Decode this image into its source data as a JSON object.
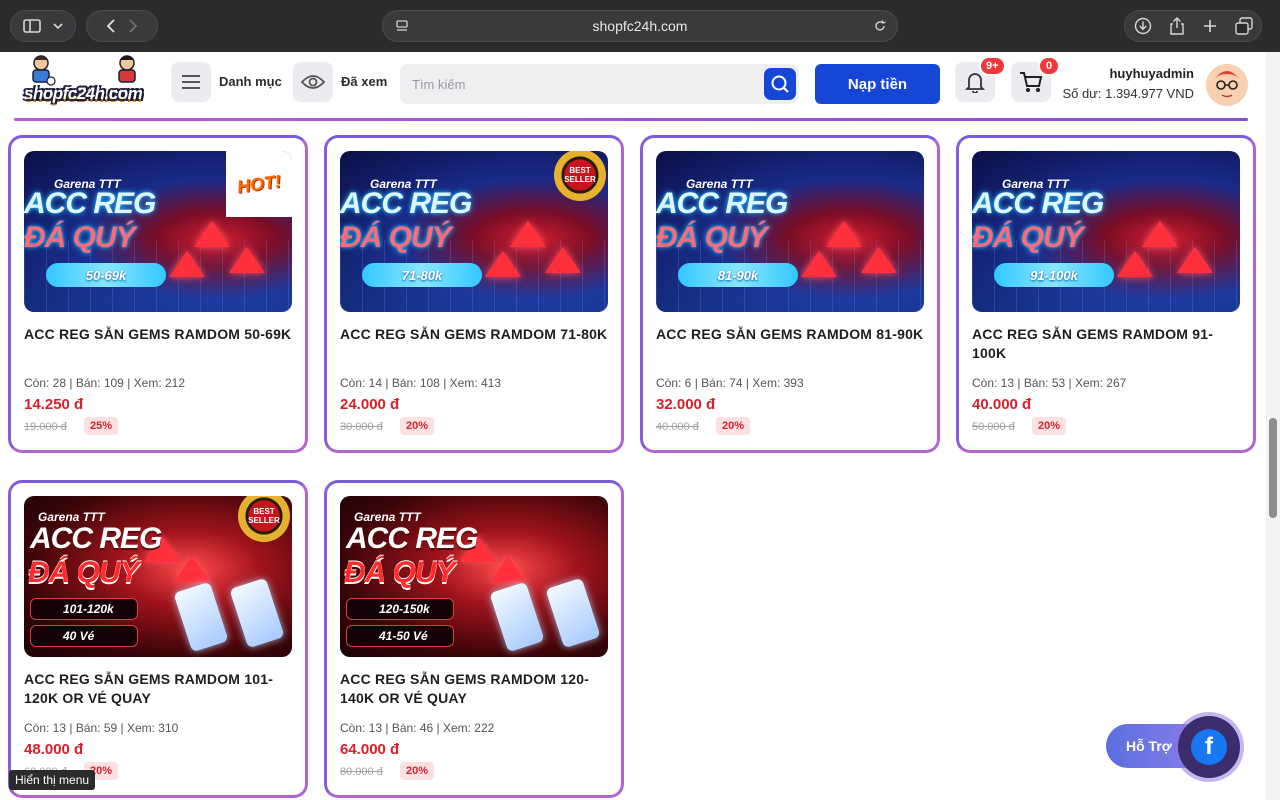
{
  "browser": {
    "url": "shopfc24h.com"
  },
  "header": {
    "logo_text": "shopfc24h.com",
    "menu_label": "Danh mục",
    "viewed_label": "Đã xem",
    "search_placeholder": "Tìm kiếm",
    "topup_label": "Nạp tiền",
    "notifications_count": "9+",
    "cart_count": "0",
    "username": "huyhuyadmin",
    "balance": "Số dư: 1.394.977 VND"
  },
  "products": [
    {
      "title": "ACC REG SẴN GEMS RAMDOM 50-69K",
      "stats": "Còn: 28 | Bán: 109 | Xem: 212",
      "price": "14.250 đ",
      "old_price": "19.000 đ",
      "discount": "25%",
      "img_brand": "Garena TTT",
      "img_line1": "ACC REG",
      "img_line2": "ĐÁ QUÝ",
      "img_range": "50-69k",
      "badge": "hot",
      "badge_text": "HOT!"
    },
    {
      "title": "ACC REG SẴN GEMS RAMDOM 71-80K",
      "stats": "Còn: 14 | Bán: 108 | Xem: 413",
      "price": "24.000 đ",
      "old_price": "30.000 đ",
      "discount": "20%",
      "img_brand": "Garena TTT",
      "img_line1": "ACC REG",
      "img_line2": "ĐÁ QUÝ",
      "img_range": "71-80k",
      "badge": "best",
      "badge_text": "BEST SELLER"
    },
    {
      "title": "ACC REG SẴN GEMS RAMDOM 81-90K",
      "stats": "Còn: 6 | Bán: 74 | Xem: 393",
      "price": "32.000 đ",
      "old_price": "40.000 đ",
      "discount": "20%",
      "img_brand": "Garena TTT",
      "img_line1": "ACC REG",
      "img_line2": "ĐÁ QUÝ",
      "img_range": "81-90k",
      "badge": "",
      "badge_text": ""
    },
    {
      "title": "ACC REG SẴN GEMS RAMDOM 91-100K",
      "stats": "Còn: 13 | Bán: 53 | Xem: 267",
      "price": "40.000 đ",
      "old_price": "50.000 đ",
      "discount": "20%",
      "img_brand": "Garena TTT",
      "img_line1": "ACC REG",
      "img_line2": "ĐÁ QUÝ",
      "img_range": "91-100k",
      "badge": "",
      "badge_text": ""
    },
    {
      "title": "ACC REG SẴN GEMS RAMDOM 101-120K OR VÉ QUAY",
      "stats": "Còn: 13 | Bán: 59 | Xem: 310",
      "price": "48.000 đ",
      "old_price": "60.000 đ",
      "discount": "20%",
      "img_brand": "Garena TTT",
      "img_line1": "ACC REG",
      "img_line2": "ĐÁ QUÝ",
      "img_range": "101-120k",
      "img_tickets": "40 Vé",
      "badge": "best",
      "badge_text": "BEST SELLER"
    },
    {
      "title": "ACC REG SẴN GEMS RAMDOM 120-140K OR VÉ QUAY",
      "stats": "Còn: 13 | Bán: 46 | Xem: 222",
      "price": "64.000 đ",
      "old_price": "80.000 đ",
      "discount": "20%",
      "img_brand": "Garena TTT",
      "img_line1": "ACC REG",
      "img_line2": "ĐÁ QUÝ",
      "img_range": "120-150k",
      "img_tickets": "41-50 Vé",
      "badge": "",
      "badge_text": ""
    }
  ],
  "floating": {
    "support_label": "Hỗ Trợ",
    "facebook_glyph": "f",
    "tooltip": "Hiển thị menu"
  },
  "colors": {
    "primary": "#1546d6",
    "price_red": "#d8202c",
    "card_border": "#b264d3"
  }
}
